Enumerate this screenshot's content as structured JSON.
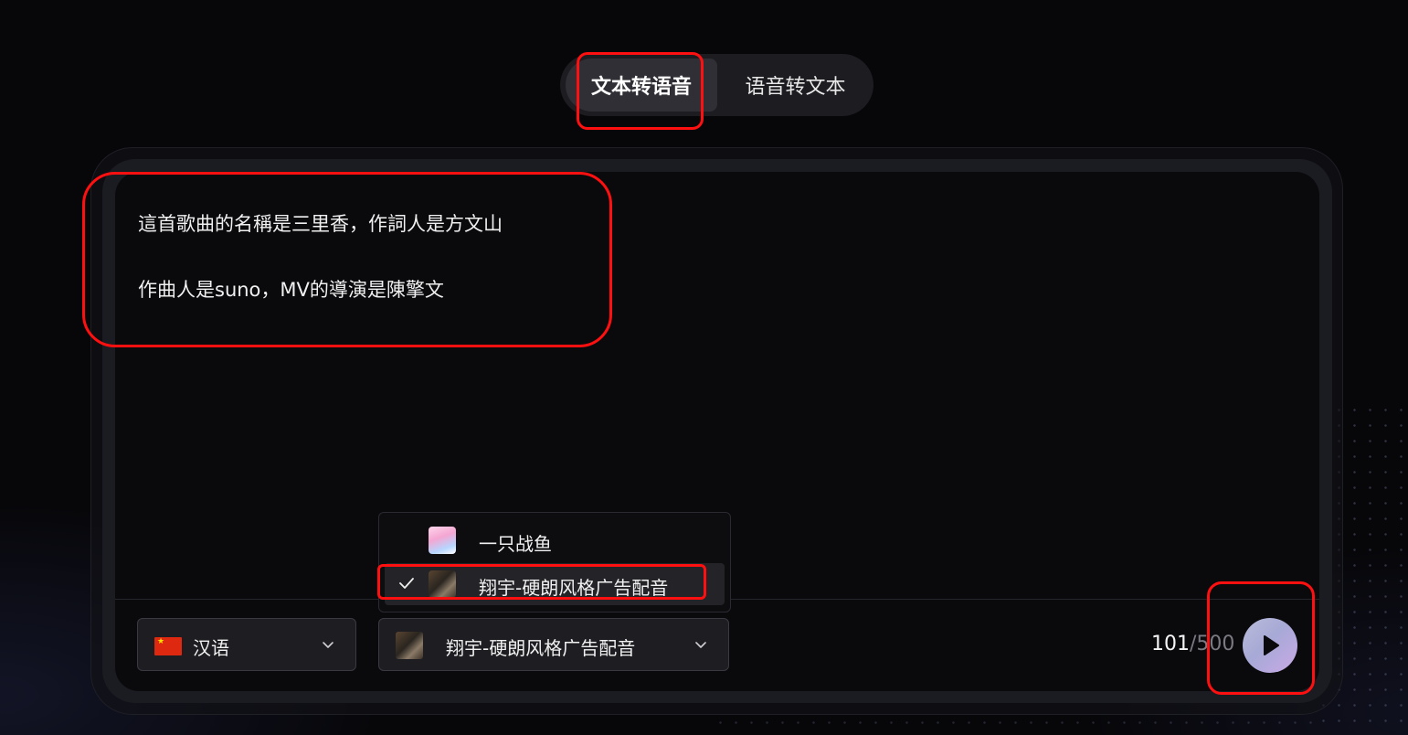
{
  "tabs": [
    {
      "label": "文本转语音",
      "active": true
    },
    {
      "label": "语音转文本",
      "active": false
    }
  ],
  "editor": {
    "lines": [
      "這首歌曲的名稱是三里香，作詞人是方文山",
      "作曲人是suno，MV的導演是陳擎文"
    ]
  },
  "language_select": {
    "flag": "cn-flag",
    "label": "汉语",
    "icon": "chevron-down-icon"
  },
  "voice_select": {
    "label": "翔宇-硬朗风格广告配音",
    "icon": "chevron-down-icon"
  },
  "voice_dropdown": {
    "items": [
      {
        "label": "一只战鱼",
        "selected": false
      },
      {
        "label": "翔宇-硬朗风格广告配音",
        "selected": true
      }
    ]
  },
  "counter": {
    "current": "101",
    "separator": "/",
    "max": "500"
  },
  "play_button": {
    "icon": "play-icon"
  },
  "colors": {
    "annotation": "#ff1010",
    "play_gradient_start": "#b9bcd9",
    "play_gradient_end": "#c9a9e6",
    "flag_red": "#de2910"
  }
}
